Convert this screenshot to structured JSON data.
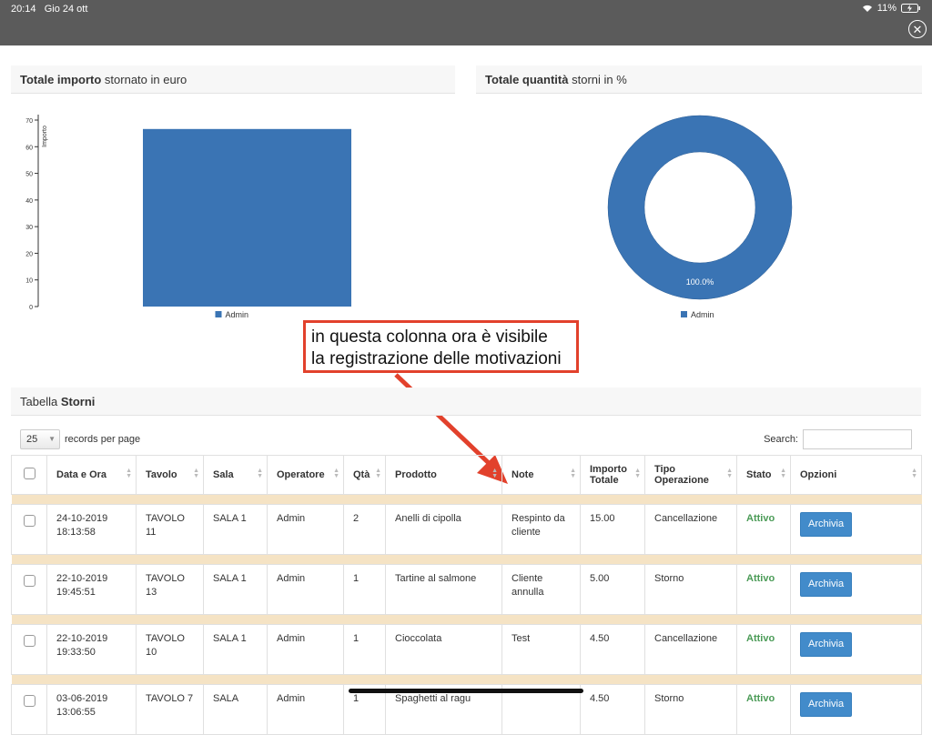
{
  "status": {
    "time": "20:14",
    "date": "Gio 24 ott",
    "battery": "11%"
  },
  "panels": {
    "left": {
      "title_bold": "Totale importo",
      "title_rest": " stornato in euro"
    },
    "right": {
      "title_bold": "Totale quantità",
      "title_rest": " storni in %"
    }
  },
  "chart_data": [
    {
      "type": "bar",
      "categories": [
        "Admin"
      ],
      "values": [
        66.65
      ],
      "ylabel": "Importo",
      "ylim": [
        0,
        70
      ],
      "yticks": [
        0,
        10,
        20,
        30,
        40,
        50,
        60,
        70
      ],
      "legend": [
        "Admin"
      ],
      "legend_position": "bottom",
      "color": "#3a74b4"
    },
    {
      "type": "pie",
      "categories": [
        "Admin"
      ],
      "values": [
        100.0
      ],
      "slice_labels": [
        "100.0%"
      ],
      "legend": [
        "Admin"
      ],
      "legend_position": "bottom",
      "color": "#3a74b4",
      "donut": true
    }
  ],
  "annotation": {
    "line1": "in questa colonna ora è visibile",
    "line2": "la registrazione delle motivazioni",
    "color": "#e2412c"
  },
  "table_section": {
    "title_plain": "Tabella ",
    "title_bold": "Storni"
  },
  "controls": {
    "page_length": "25",
    "records_label": "records per page",
    "search_label": "Search:"
  },
  "table": {
    "headers": [
      "Data e Ora",
      "Tavolo",
      "Sala",
      "Operatore",
      "Qtà",
      "Prodotto",
      "Note",
      "Importo Totale",
      "Tipo Operazione",
      "Stato",
      "Opzioni"
    ],
    "action_label": "Archivia",
    "rows": [
      {
        "data": "24-10-2019 18:13:58",
        "tavolo": "TAVOLO 11",
        "sala": "SALA 1",
        "operatore": "Admin",
        "qta": "2",
        "prodotto": "Anelli di cipolla",
        "note": "Respinto da cliente",
        "importo": "15.00",
        "tipo": "Cancellazione",
        "stato": "Attivo"
      },
      {
        "data": "22-10-2019 19:45:51",
        "tavolo": "TAVOLO 13",
        "sala": "SALA 1",
        "operatore": "Admin",
        "qta": "1",
        "prodotto": "Tartine al salmone",
        "note": "Cliente annulla",
        "importo": "5.00",
        "tipo": "Storno",
        "stato": "Attivo"
      },
      {
        "data": "22-10-2019 19:33:50",
        "tavolo": "TAVOLO 10",
        "sala": "SALA 1",
        "operatore": "Admin",
        "qta": "1",
        "prodotto": "Cioccolata",
        "note": "Test",
        "importo": "4.50",
        "tipo": "Cancellazione",
        "stato": "Attivo"
      },
      {
        "data": "03-06-2019 13:06:55",
        "tavolo": "TAVOLO 7",
        "sala": "SALA",
        "operatore": "Admin",
        "qta": "1",
        "prodotto": "Spaghetti al ragu",
        "note": "",
        "importo": "4.50",
        "tipo": "Storno",
        "stato": "Attivo"
      }
    ]
  }
}
